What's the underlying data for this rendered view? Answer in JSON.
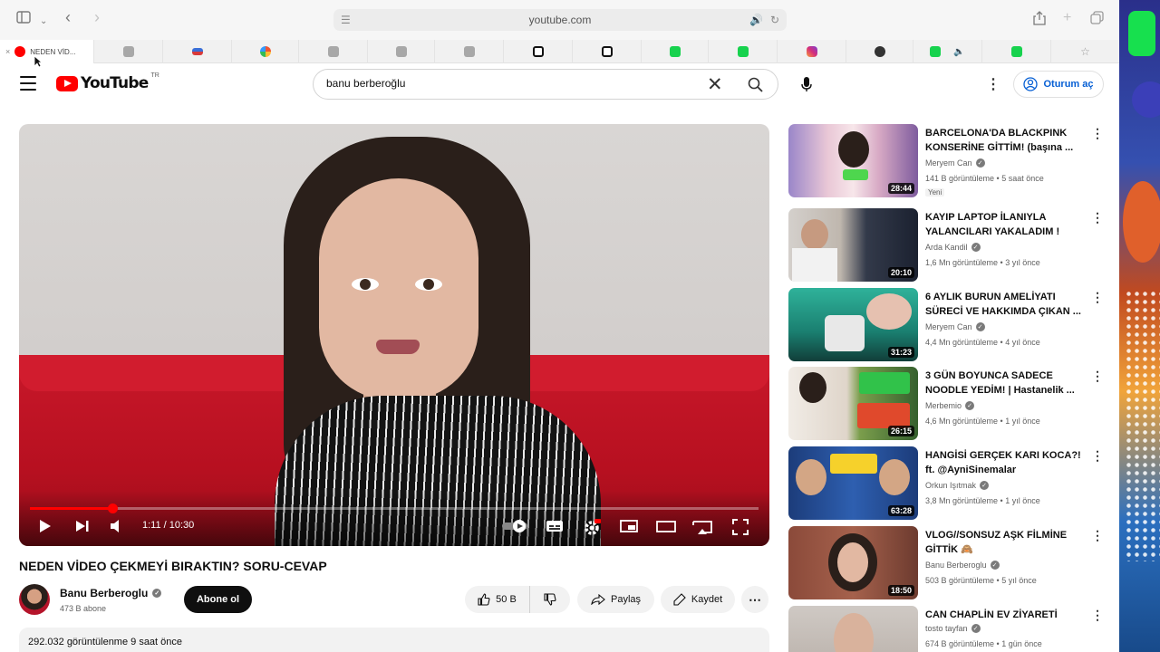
{
  "browser": {
    "address": "youtube.com",
    "active_tab_title": "NEDEN VİD..."
  },
  "youtube": {
    "logo_text": "YouTube",
    "region": "TR",
    "search_value": "banu berberoğlu",
    "signin_label": "Oturum aç"
  },
  "player": {
    "time": "1:11 / 10:30",
    "progress_fraction": 0.113
  },
  "video": {
    "title": "NEDEN VİDEO ÇEKMEYİ BIRAKTIN? SORU-CEVAP",
    "channel": "Banu Berberoglu",
    "subscribers": "473 B abone",
    "subscribe_label": "Abone ol",
    "likes": "50 B",
    "share_label": "Paylaş",
    "save_label": "Kaydet",
    "views_line": "292.032 görüntülenme  9 saat önce"
  },
  "recommendations": [
    {
      "title": "BARCELONA'DA BLACKPINK KONSERİNE GİTTİM! (başına ...",
      "channel": "Meryem Can",
      "meta": "141 B görüntüleme • 5 saat önce",
      "badge": "Yeni",
      "duration": "28:44"
    },
    {
      "title": "KAYIP LAPTOP İLANIYLA YALANCILARI YAKALADIM !",
      "channel": "Arda Kandil",
      "meta": "1,6 Mn görüntüleme • 3 yıl önce",
      "duration": "20:10"
    },
    {
      "title": "6 AYLIK BURUN AMELİYATI SÜRECİ VE HAKKIMDA ÇIKAN ...",
      "channel": "Meryem Can",
      "meta": "4,4 Mn görüntüleme • 4 yıl önce",
      "duration": "31:23"
    },
    {
      "title": "3 GÜN BOYUNCA SADECE NOODLE YEDİM! | Hastanelik ...",
      "channel": "Merbemio",
      "meta": "4,6 Mn görüntüleme • 1 yıl önce",
      "duration": "26:15"
    },
    {
      "title": "HANGİSİ GERÇEK KARI KOCA?! ft. @AyniSinemalar",
      "channel": "Orkun Işıtmak",
      "meta": "3,8 Mn görüntüleme • 1 yıl önce",
      "duration": "63:28"
    },
    {
      "title": "VLOG//SONSUZ AŞK FİLMİNE GİTTİK 🙈",
      "channel": "Banu Berberoglu",
      "meta": "503 B görüntüleme • 5 yıl önce",
      "duration": "18:50"
    },
    {
      "title": "CAN CHAPLİN EV ZİYARETİ",
      "channel": "tosto tayfan",
      "meta": "674 B görüntüleme • 1 gün önce",
      "duration": ""
    }
  ],
  "colors": {
    "brand_red": "#ff0000",
    "link_blue": "#065fd4"
  }
}
